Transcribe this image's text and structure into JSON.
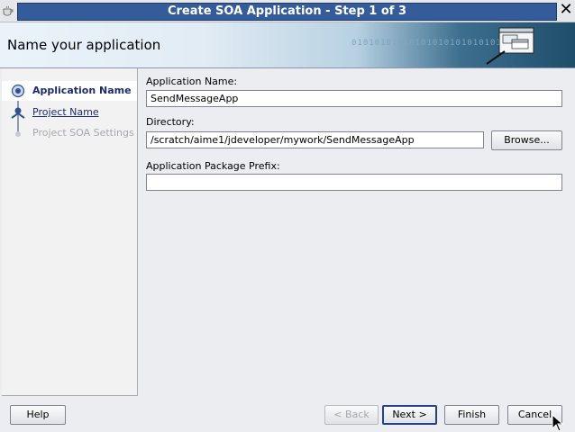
{
  "window": {
    "title": "Create SOA Application - Step 1 of 3"
  },
  "header": {
    "heading": "Name your application",
    "binary_text": "010101010101010101010101010"
  },
  "steps": [
    {
      "label": "Application Name",
      "state": "current"
    },
    {
      "label": "Project Name",
      "state": "link"
    },
    {
      "label": "Project SOA Settings",
      "state": "disabled"
    }
  ],
  "form": {
    "app_name_label": "Application Name:",
    "app_name_value": "SendMessageApp",
    "directory_label": "Directory:",
    "directory_value": "/scratch/aime1/jdeveloper/mywork/SendMessageApp",
    "browse_label": "Browse...",
    "prefix_label": "Application Package Prefix:",
    "prefix_value": ""
  },
  "buttons": {
    "help": "Help",
    "back": "< Back",
    "next": "Next >",
    "finish": "Finish",
    "cancel": "Cancel"
  },
  "icons": {
    "app": "coffee-cup-icon",
    "close": "close-icon",
    "header": "application-windows-icon",
    "cursor": "mouse-pointer-icon"
  },
  "colors": {
    "titlebar": "#355c9a",
    "link": "#1d2d6b",
    "focus": "#27428a"
  }
}
